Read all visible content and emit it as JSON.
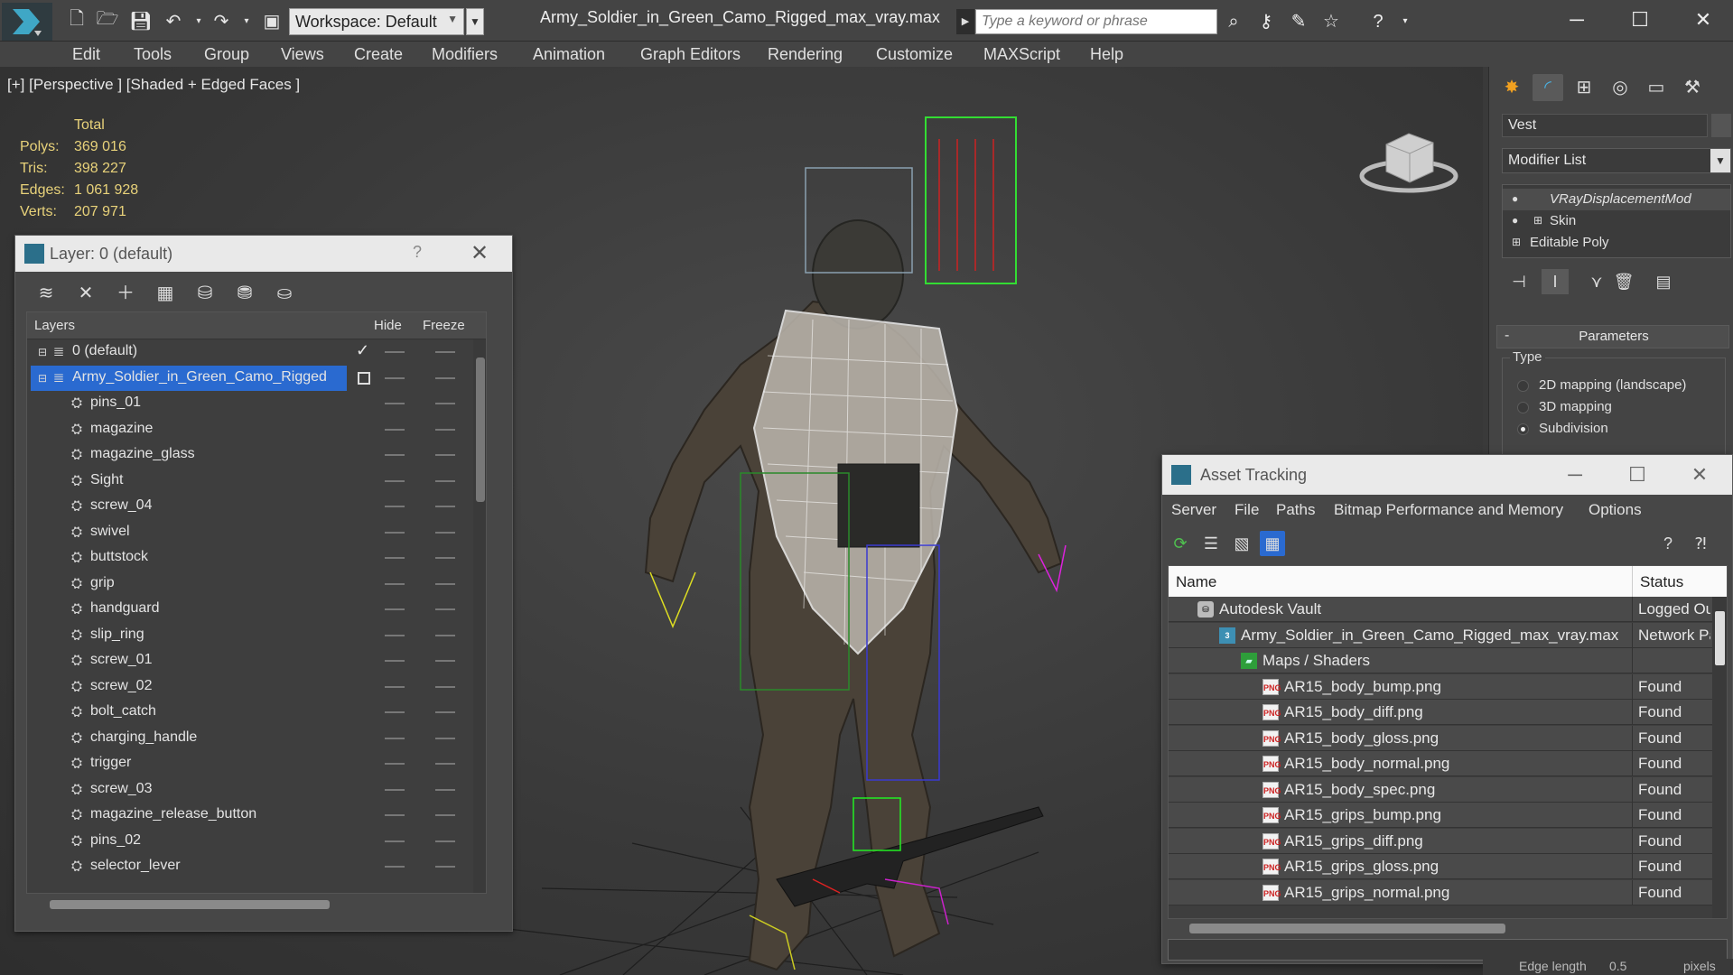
{
  "titlebar": {
    "workspace_label": "Workspace: Default",
    "doc_title": "Army_Soldier_in_Green_Camo_Rigged_max_vray.max",
    "search_placeholder": "Type a keyword or phrase",
    "window_controls": {
      "minimize": "─",
      "maximize": "☐",
      "close": "✕"
    }
  },
  "menu": [
    "Edit",
    "Tools",
    "Group",
    "Views",
    "Create",
    "Modifiers",
    "Animation",
    "Graph Editors",
    "Rendering",
    "Customize",
    "MAXScript",
    "Help"
  ],
  "viewport": {
    "label": "[+] [Perspective ] [Shaded + Edged Faces ]",
    "stats": {
      "header": "Total",
      "rows": [
        {
          "label": "Polys:",
          "value": "369 016"
        },
        {
          "label": "Tris:",
          "value": "398 227"
        },
        {
          "label": "Edges:",
          "value": "1 061 928"
        },
        {
          "label": "Verts:",
          "value": "207 971"
        }
      ]
    }
  },
  "layer_dialog": {
    "title": "Layer: 0 (default)",
    "help": "?",
    "columns": {
      "layers": "Layers",
      "hide": "Hide",
      "freeze": "Freeze"
    },
    "layers": [
      {
        "name": "0 (default)",
        "level": 0,
        "current": true
      },
      {
        "name": "Army_Soldier_in_Green_Camo_Rigged",
        "level": 0,
        "selected": true
      },
      {
        "name": "pins_01",
        "level": 1
      },
      {
        "name": "magazine",
        "level": 1
      },
      {
        "name": "magazine_glass",
        "level": 1
      },
      {
        "name": "Sight",
        "level": 1
      },
      {
        "name": "screw_04",
        "level": 1
      },
      {
        "name": "swivel",
        "level": 1
      },
      {
        "name": "buttstock",
        "level": 1
      },
      {
        "name": "grip",
        "level": 1
      },
      {
        "name": "handguard",
        "level": 1
      },
      {
        "name": "slip_ring",
        "level": 1
      },
      {
        "name": "screw_01",
        "level": 1
      },
      {
        "name": "screw_02",
        "level": 1
      },
      {
        "name": "bolt_catch",
        "level": 1
      },
      {
        "name": "charging_handle",
        "level": 1
      },
      {
        "name": "trigger",
        "level": 1
      },
      {
        "name": "screw_03",
        "level": 1
      },
      {
        "name": "magazine_release_button",
        "level": 1
      },
      {
        "name": "pins_02",
        "level": 1
      },
      {
        "name": "selector_lever",
        "level": 1
      }
    ]
  },
  "command_panel": {
    "object_name": "Vest",
    "modifier_list": "Modifier List",
    "stack": [
      "VRayDisplacementMod",
      "Skin",
      "Editable Poly"
    ],
    "rollout_title": "Parameters",
    "type_group": "Type",
    "type_options": [
      {
        "label": "2D mapping (landscape)",
        "selected": false
      },
      {
        "label": "3D mapping",
        "selected": false
      },
      {
        "label": "Subdivision",
        "selected": true
      }
    ]
  },
  "asset_tracking": {
    "title": "Asset Tracking",
    "menu": [
      "Server",
      "File",
      "Paths",
      "Bitmap Performance and Memory",
      "Options"
    ],
    "columns": {
      "name": "Name",
      "status": "Status"
    },
    "rows": [
      {
        "name": "Autodesk Vault",
        "status": "Logged Out",
        "icon": "vault",
        "level": 1
      },
      {
        "name": "Army_Soldier_in_Green_Camo_Rigged_max_vray.max",
        "status": "Network Path",
        "icon": "max",
        "level": 2
      },
      {
        "name": "Maps / Shaders",
        "status": "",
        "icon": "folder",
        "level": 3
      },
      {
        "name": "AR15_body_bump.png",
        "status": "Found",
        "icon": "png",
        "level": 4
      },
      {
        "name": "AR15_body_diff.png",
        "status": "Found",
        "icon": "png",
        "level": 4
      },
      {
        "name": "AR15_body_gloss.png",
        "status": "Found",
        "icon": "png",
        "level": 4
      },
      {
        "name": "AR15_body_normal.png",
        "status": "Found",
        "icon": "png",
        "level": 4
      },
      {
        "name": "AR15_body_spec.png",
        "status": "Found",
        "icon": "png",
        "level": 4
      },
      {
        "name": "AR15_grips_bump.png",
        "status": "Found",
        "icon": "png",
        "level": 4
      },
      {
        "name": "AR15_grips_diff.png",
        "status": "Found",
        "icon": "png",
        "level": 4
      },
      {
        "name": "AR15_grips_gloss.png",
        "status": "Found",
        "icon": "png",
        "level": 4
      },
      {
        "name": "AR15_grips_normal.png",
        "status": "Found",
        "icon": "png",
        "level": 4
      }
    ]
  },
  "statusbar": {
    "edge_length_label": "Edge length",
    "edge_length_value": "0.5",
    "units": "pixels"
  },
  "colors": {
    "selection": "#2a6ad0",
    "stats_text": "#e8d27a",
    "viewport_bg": "#3a3a3a"
  }
}
